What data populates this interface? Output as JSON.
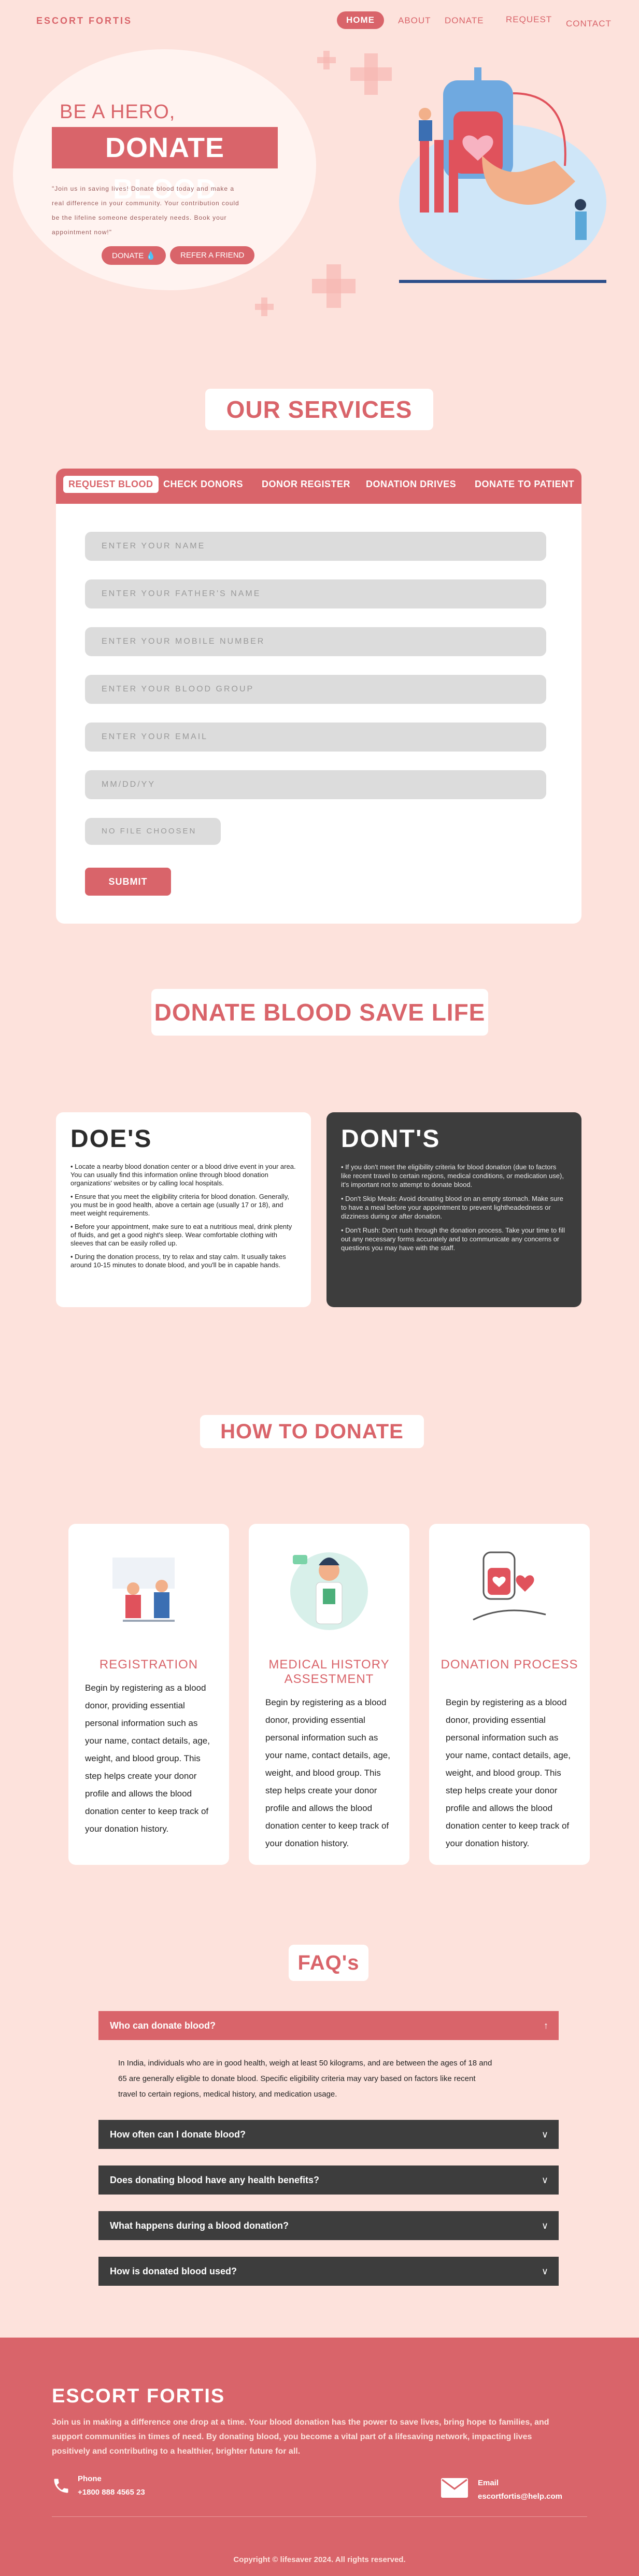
{
  "nav": {
    "brand": "ESCORT FORTIS",
    "items": [
      "HOME",
      "ABOUT",
      "DONATE",
      "REQUEST",
      "CONTACT"
    ]
  },
  "hero": {
    "subtitle": "BE A HERO,",
    "title": "DONATE BLOOD",
    "text": "\"Join us in saving lives! Donate blood today and make a real difference in your community. Your contribution could be the lifeline someone desperately needs. Book your appointment now!\"",
    "donate_btn": "DONATE",
    "refer_btn": "REFER A FRIEND"
  },
  "services": {
    "heading": "OUR SERVICES",
    "tabs": [
      "REQUEST BLOOD",
      "CHECK DONORS",
      "DONOR REGISTER",
      "DONATION DRIVES",
      "DONATE TO PATIENT"
    ],
    "fields": {
      "name": "ENTER YOUR NAME",
      "father": "ENTER YOUR FATHER'S NAME",
      "mobile": "ENTER YOUR MOBILE NUMBER",
      "blood_group": "ENTER YOUR BLOOD GROUP",
      "email": "ENTER YOUR EMAIL",
      "date": "MM/DD/YY",
      "file": "NO FILE CHOOSEN"
    },
    "submit": "SUBMIT"
  },
  "save_life": {
    "heading": "DONATE BLOOD SAVE LIFE",
    "dos_title": "DOE'S",
    "dos": [
      "• Locate a nearby blood donation center or a blood drive event in your area. You can usually find this information online through blood donation organizations' websites or by calling local hospitals.",
      "•  Ensure that you meet the eligibility criteria for blood donation. Generally, you must be in good health, above a certain age (usually 17 or 18), and meet weight requirements.",
      "•  Before your appointment, make sure to eat a nutritious meal, drink plenty of fluids, and get a good night's sleep. Wear comfortable clothing with sleeves that can be easily rolled up.",
      "• During the donation process, try to relax and stay calm. It usually takes around 10-15 minutes to donate blood, and you'll be in capable hands."
    ],
    "donts_title": "DONT'S",
    "donts": [
      "•  If you don't meet the eligibility criteria for blood donation (due to factors like recent travel to certain regions, medical conditions, or medication use), it's important not to attempt to donate blood.",
      "•  Don't Skip Meals: Avoid donating blood on an empty stomach. Make sure to have a meal before your appointment to prevent lightheadedness or dizziness during or after donation.",
      "•  Don't Rush: Don't rush through the donation process. Take your time to fill out any necessary forms accurately and to communicate any concerns or questions you may have with the staff."
    ]
  },
  "how": {
    "heading": "HOW TO DONATE",
    "body": "Begin by registering as a blood donor, providing essential personal information such as your name, contact details, age, weight, and blood group. This step helps create your donor profile and allows the blood donation center to keep track of your donation history.",
    "steps": [
      {
        "title": "REGISTRATION"
      },
      {
        "title": "MEDICAL HISTORY ASSESTMENT"
      },
      {
        "title": "DONATION PROCESS"
      }
    ]
  },
  "faq": {
    "heading": "FAQ's",
    "items": [
      "Who can donate blood?",
      "How often can I donate blood?",
      "Does donating blood have any health benefits?",
      "What happens during a blood donation?",
      "How is donated blood used?"
    ],
    "answer": "In India, individuals who are in good health, weigh at least 50 kilograms, and are between the ages of 18 and 65 are generally eligible to donate blood. Specific eligibility criteria may vary based on factors like recent travel to certain regions, medical history, and medication usage."
  },
  "footer": {
    "brand": "ESCORT FORTIS",
    "text": "Join us in making a difference one drop at a time. Your blood donation has the power to save lives, bring hope to families, and support communities in times of need. By donating blood, you become a vital part of a lifesaving network, impacting lives positively and contributing to a healthier, brighter future for all.",
    "phone_label": "Phone",
    "phone": "+1800 888 4565 23",
    "email_label": "Email",
    "email": "escortfortis@help.com",
    "copyright": "Copyright © lifesaver 2024. All rights reserved."
  },
  "colors": {
    "brand": "#d9646a",
    "background": "#fde2dc",
    "dark": "#3d3d3d"
  }
}
